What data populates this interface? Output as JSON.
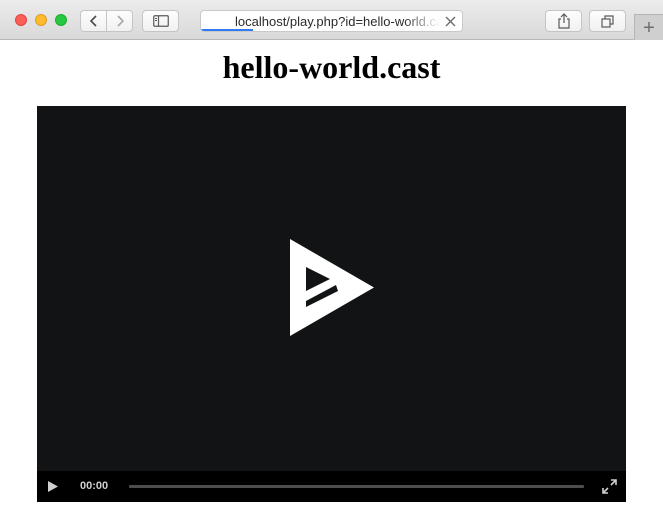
{
  "browser": {
    "url": "localhost/play.php?id=hello-world.cast",
    "load_progress": 0.2,
    "new_tab_label": "+"
  },
  "page": {
    "title": "hello-world.cast"
  },
  "player": {
    "current_time": "00:00",
    "playback_progress": 0,
    "colors": {
      "background": "#121314",
      "controls": "#000000",
      "foreground": "#ffffff"
    },
    "icons": {
      "center": "asciinema-play-logo-icon",
      "play": "play-icon",
      "fullscreen": "fullscreen-icon"
    }
  }
}
